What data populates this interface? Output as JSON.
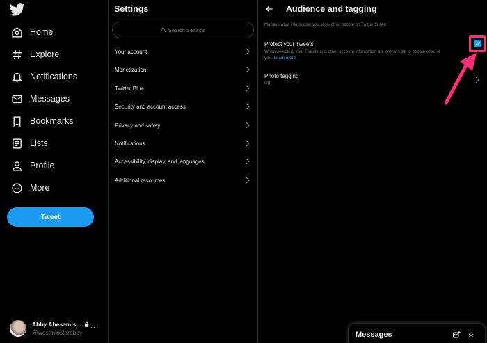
{
  "nav": {
    "logo_icon": "twitter-bird-icon",
    "items": [
      {
        "label": "Home",
        "icon": "home-icon"
      },
      {
        "label": "Explore",
        "icon": "hashtag-icon"
      },
      {
        "label": "Notifications",
        "icon": "bell-icon"
      },
      {
        "label": "Messages",
        "icon": "envelope-icon"
      },
      {
        "label": "Bookmarks",
        "icon": "bookmark-icon"
      },
      {
        "label": "Lists",
        "icon": "list-icon"
      },
      {
        "label": "Profile",
        "icon": "person-icon"
      },
      {
        "label": "More",
        "icon": "more-circle-icon"
      }
    ],
    "tweet_label": "Tweet"
  },
  "account": {
    "name": "Abby Abesamis...",
    "handle": "@westminsterabby",
    "more": "···"
  },
  "settings": {
    "title": "Settings",
    "search_placeholder": "Search Settings",
    "items": [
      {
        "label": "Your account"
      },
      {
        "label": "Monetization"
      },
      {
        "label": "Twitter Blue"
      },
      {
        "label": "Security and account access"
      },
      {
        "label": "Privacy and safety"
      },
      {
        "label": "Notifications"
      },
      {
        "label": "Accessibility, display, and languages"
      },
      {
        "label": "Additional resources"
      }
    ]
  },
  "main": {
    "title": "Audience and tagging",
    "description": "Manage what information you allow other people on Twitter to see.",
    "protect": {
      "title": "Protect your Tweets",
      "description": "When selected, your Tweets and other account information are only visible to people who fol",
      "description_cont": "you.",
      "learn_more": "Learn more",
      "checked": true
    },
    "photo_tagging": {
      "title": "Photo tagging",
      "value": "Off"
    }
  },
  "messages_drawer": {
    "title": "Messages"
  },
  "colors": {
    "background": "#000000",
    "accent": "#1d9bf0",
    "highlight": "#ff2d78",
    "muted_text": "#71767b",
    "divider": "#2f3336"
  }
}
